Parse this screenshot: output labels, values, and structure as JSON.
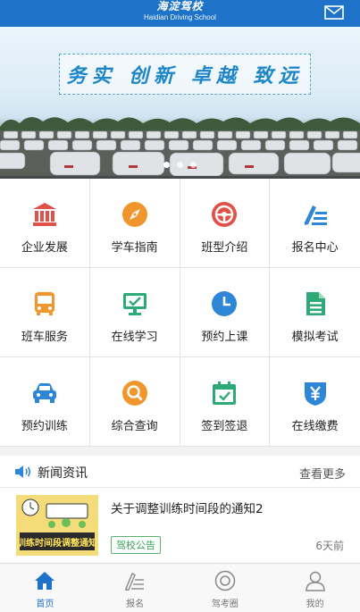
{
  "header": {
    "brand_cn": "海淀驾校",
    "brand_en": "Haidian Driving School",
    "mail_icon": "mail-icon"
  },
  "banner": {
    "slogan": "务实 创新 卓越 致远",
    "slide_count": 3,
    "active_slide": 1
  },
  "menu": [
    {
      "label": "企业发展",
      "icon": "bank-icon",
      "color": "#e2504a"
    },
    {
      "label": "学车指南",
      "icon": "compass-icon",
      "color": "#f0962c"
    },
    {
      "label": "班型介绍",
      "icon": "steering-wheel-icon",
      "color": "#e2504a"
    },
    {
      "label": "报名中心",
      "icon": "edit-list-icon",
      "color": "#2e86d6"
    },
    {
      "label": "班车服务",
      "icon": "bus-icon",
      "color": "#f0962c"
    },
    {
      "label": "在线学习",
      "icon": "monitor-check-icon",
      "color": "#2eaa78"
    },
    {
      "label": "预约上课",
      "icon": "clock-icon",
      "color": "#2e86d6"
    },
    {
      "label": "模拟考试",
      "icon": "document-icon",
      "color": "#2eaa78"
    },
    {
      "label": "预约训练",
      "icon": "car-icon",
      "color": "#2e86d6"
    },
    {
      "label": "综合查询",
      "icon": "search-icon",
      "color": "#f0962c"
    },
    {
      "label": "签到签退",
      "icon": "calendar-check-icon",
      "color": "#2eaa78"
    },
    {
      "label": "在线缴费",
      "icon": "yuan-shield-icon",
      "color": "#2e86d6"
    }
  ],
  "news": {
    "section_title": "新闻资讯",
    "more_label": "查看更多",
    "items": [
      {
        "title": "关于调整训练时间段的通知2",
        "tag": "驾校公告",
        "time": "6天前",
        "thumb_text": "训练时间段调整通知"
      }
    ]
  },
  "tabs": [
    {
      "label": "首页",
      "icon": "home-icon",
      "active": true
    },
    {
      "label": "报名",
      "icon": "pen-list-icon",
      "active": false
    },
    {
      "label": "驾考圈",
      "icon": "circle-target-icon",
      "active": false
    },
    {
      "label": "我的",
      "icon": "user-icon",
      "active": false
    }
  ],
  "colors": {
    "primary": "#1e73c8",
    "tag_green": "#3aa058"
  }
}
